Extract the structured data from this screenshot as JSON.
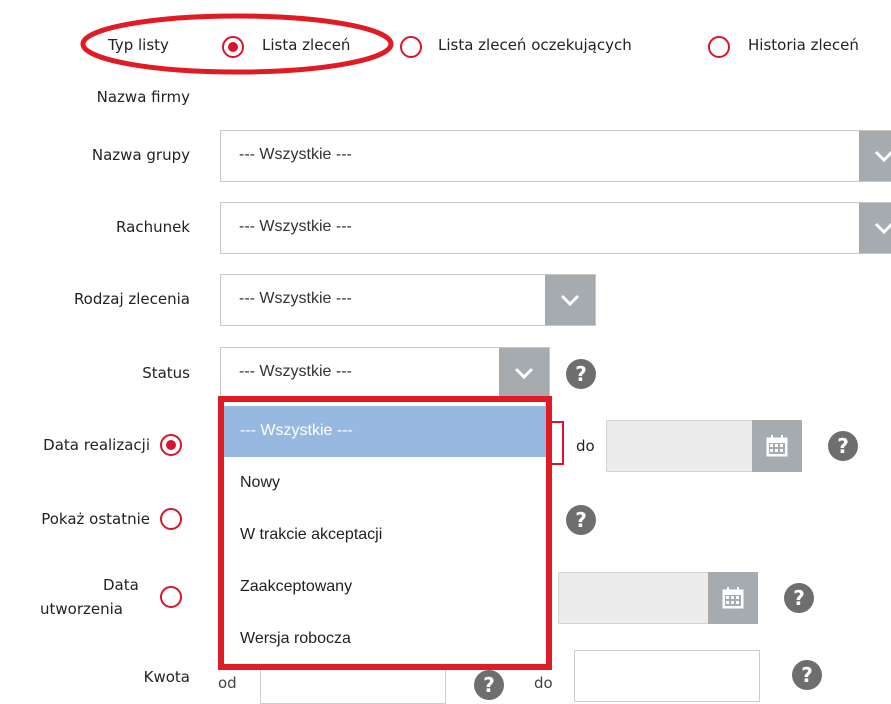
{
  "list_type": {
    "label": "Typ listy",
    "options": [
      "Lista zleceń",
      "Lista zleceń oczekujących",
      "Historia zleceń"
    ],
    "selected": 0
  },
  "company": {
    "label": "Nazwa firmy"
  },
  "group": {
    "label": "Nazwa grupy",
    "value": "--- Wszystkie ---"
  },
  "account": {
    "label": "Rachunek",
    "value": "--- Wszystkie ---"
  },
  "order_type": {
    "label": "Rodzaj zlecenia",
    "value": "--- Wszystkie ---"
  },
  "status": {
    "label": "Status",
    "value": "--- Wszystkie ---",
    "options": [
      "--- Wszystkie ---",
      "Nowy",
      "W trakcie akceptacji",
      "Zaakceptowany",
      "Wersja robocza"
    ],
    "highlighted": 0
  },
  "exec_date": {
    "label": "Data realizacji",
    "to_label": "do"
  },
  "show_last": {
    "label": "Pokaż ostatnie"
  },
  "created_date": {
    "label_line1": "Data",
    "label_line2": "utworzenia"
  },
  "amount": {
    "label": "Kwota",
    "from_label": "od",
    "to_label": "do"
  },
  "help_glyph": "?",
  "colors": {
    "accent": "#d9152b",
    "highlight_border": "#e01b24",
    "option_selected": "#97b8e0",
    "arrow_bg": "#a6abb0",
    "help_bg": "#6e6e6e"
  }
}
